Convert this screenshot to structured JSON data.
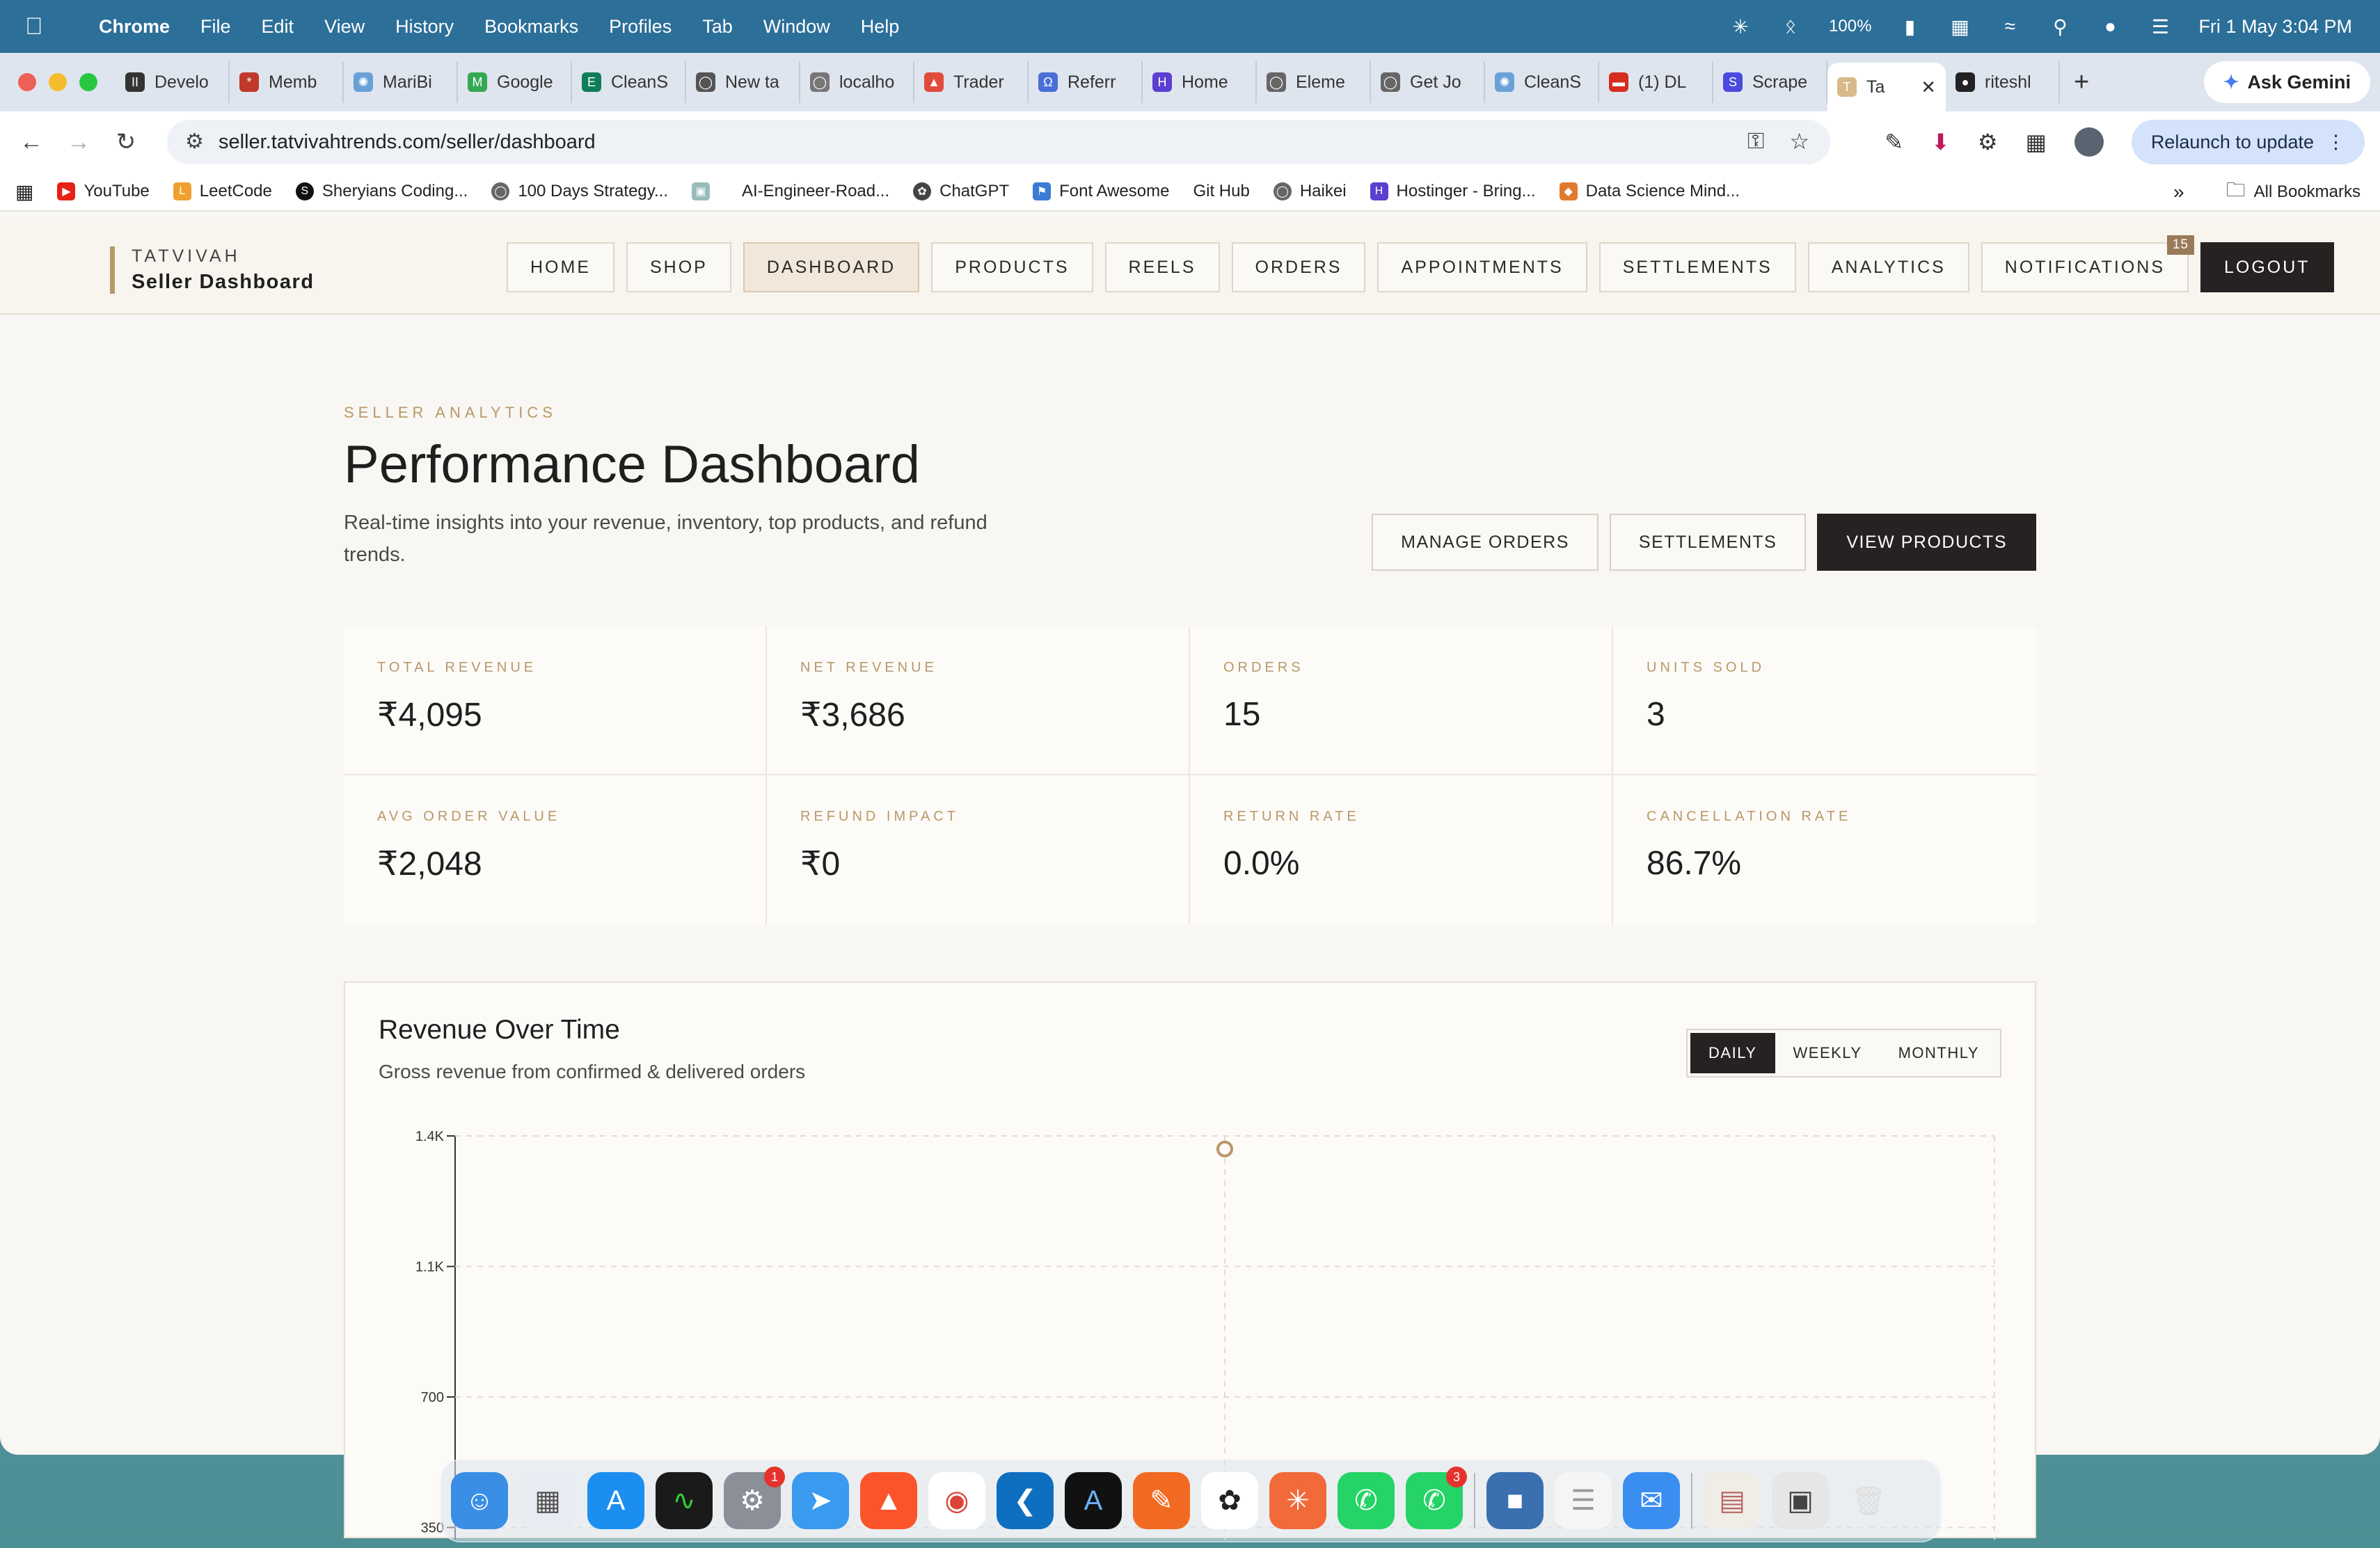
{
  "menubar": {
    "app": "Chrome",
    "items": [
      "File",
      "Edit",
      "View",
      "History",
      "Bookmarks",
      "Profiles",
      "Tab",
      "Window",
      "Help"
    ],
    "battery": "100%",
    "datetime": "Fri 1 May  3:04 PM"
  },
  "tabs": [
    "Develo",
    "Memb",
    "MariBi",
    "Google",
    "CleanS",
    "New ta",
    "localho",
    "Trader",
    "Referr",
    "Home",
    "Eleme",
    "Get Jo",
    "CleanS",
    "(1) DL",
    "Scrape",
    "Ta",
    "riteshl"
  ],
  "gemini_label": "Ask Gemini",
  "address": {
    "url": "seller.tatvivahtrends.com/seller/dashboard"
  },
  "relaunch_label": "Relaunch to update",
  "bookmarks": [
    "YouTube",
    "LeetCode",
    "Sheryians Coding...",
    "100 Days Strategy...",
    "",
    "AI-Engineer-Road...",
    "ChatGPT",
    "Font Awesome",
    "Git Hub",
    "Haikei",
    "Hostinger - Bring...",
    "Data Science Mind..."
  ],
  "all_bookmarks": "All Bookmarks",
  "site": {
    "brand_top": "TATVIVAH",
    "brand_bottom": "Seller Dashboard",
    "nav": [
      "HOME",
      "SHOP",
      "DASHBOARD",
      "PRODUCTS",
      "REELS",
      "ORDERS",
      "APPOINTMENTS",
      "SETTLEMENTS",
      "ANALYTICS",
      "NOTIFICATIONS",
      "LOGOUT"
    ],
    "notifications_count": "15"
  },
  "page": {
    "eyebrow": "SELLER ANALYTICS",
    "title": "Performance Dashboard",
    "subtitle": "Real-time insights into your revenue, inventory, top products, and refund trends.",
    "actions": [
      "MANAGE ORDERS",
      "SETTLEMENTS",
      "VIEW PRODUCTS"
    ]
  },
  "stats": [
    {
      "label": "TOTAL REVENUE",
      "value": "₹4,095"
    },
    {
      "label": "NET REVENUE",
      "value": "₹3,686"
    },
    {
      "label": "ORDERS",
      "value": "15"
    },
    {
      "label": "UNITS SOLD",
      "value": "3"
    },
    {
      "label": "AVG ORDER VALUE",
      "value": "₹2,048"
    },
    {
      "label": "REFUND IMPACT",
      "value": "₹0"
    },
    {
      "label": "RETURN RATE",
      "value": "0.0%"
    },
    {
      "label": "CANCELLATION RATE",
      "value": "86.7%"
    }
  ],
  "chart": {
    "title": "Revenue Over Time",
    "subtitle": "Gross revenue from confirmed & delivered orders",
    "toggle": [
      "DAILY",
      "WEEKLY",
      "MONTHLY"
    ],
    "active_toggle": "DAILY"
  },
  "chart_data": {
    "type": "line",
    "title": "Revenue Over Time",
    "y_ticks": [
      "1.4K",
      "1.1K",
      "700",
      "350"
    ],
    "y_tick_values": [
      1400,
      1050,
      700,
      350
    ],
    "ylim": [
      0,
      1400
    ],
    "series": [
      {
        "values": [
          1365
        ]
      }
    ],
    "grid": true,
    "colors": {
      "point": "#b89868"
    }
  }
}
